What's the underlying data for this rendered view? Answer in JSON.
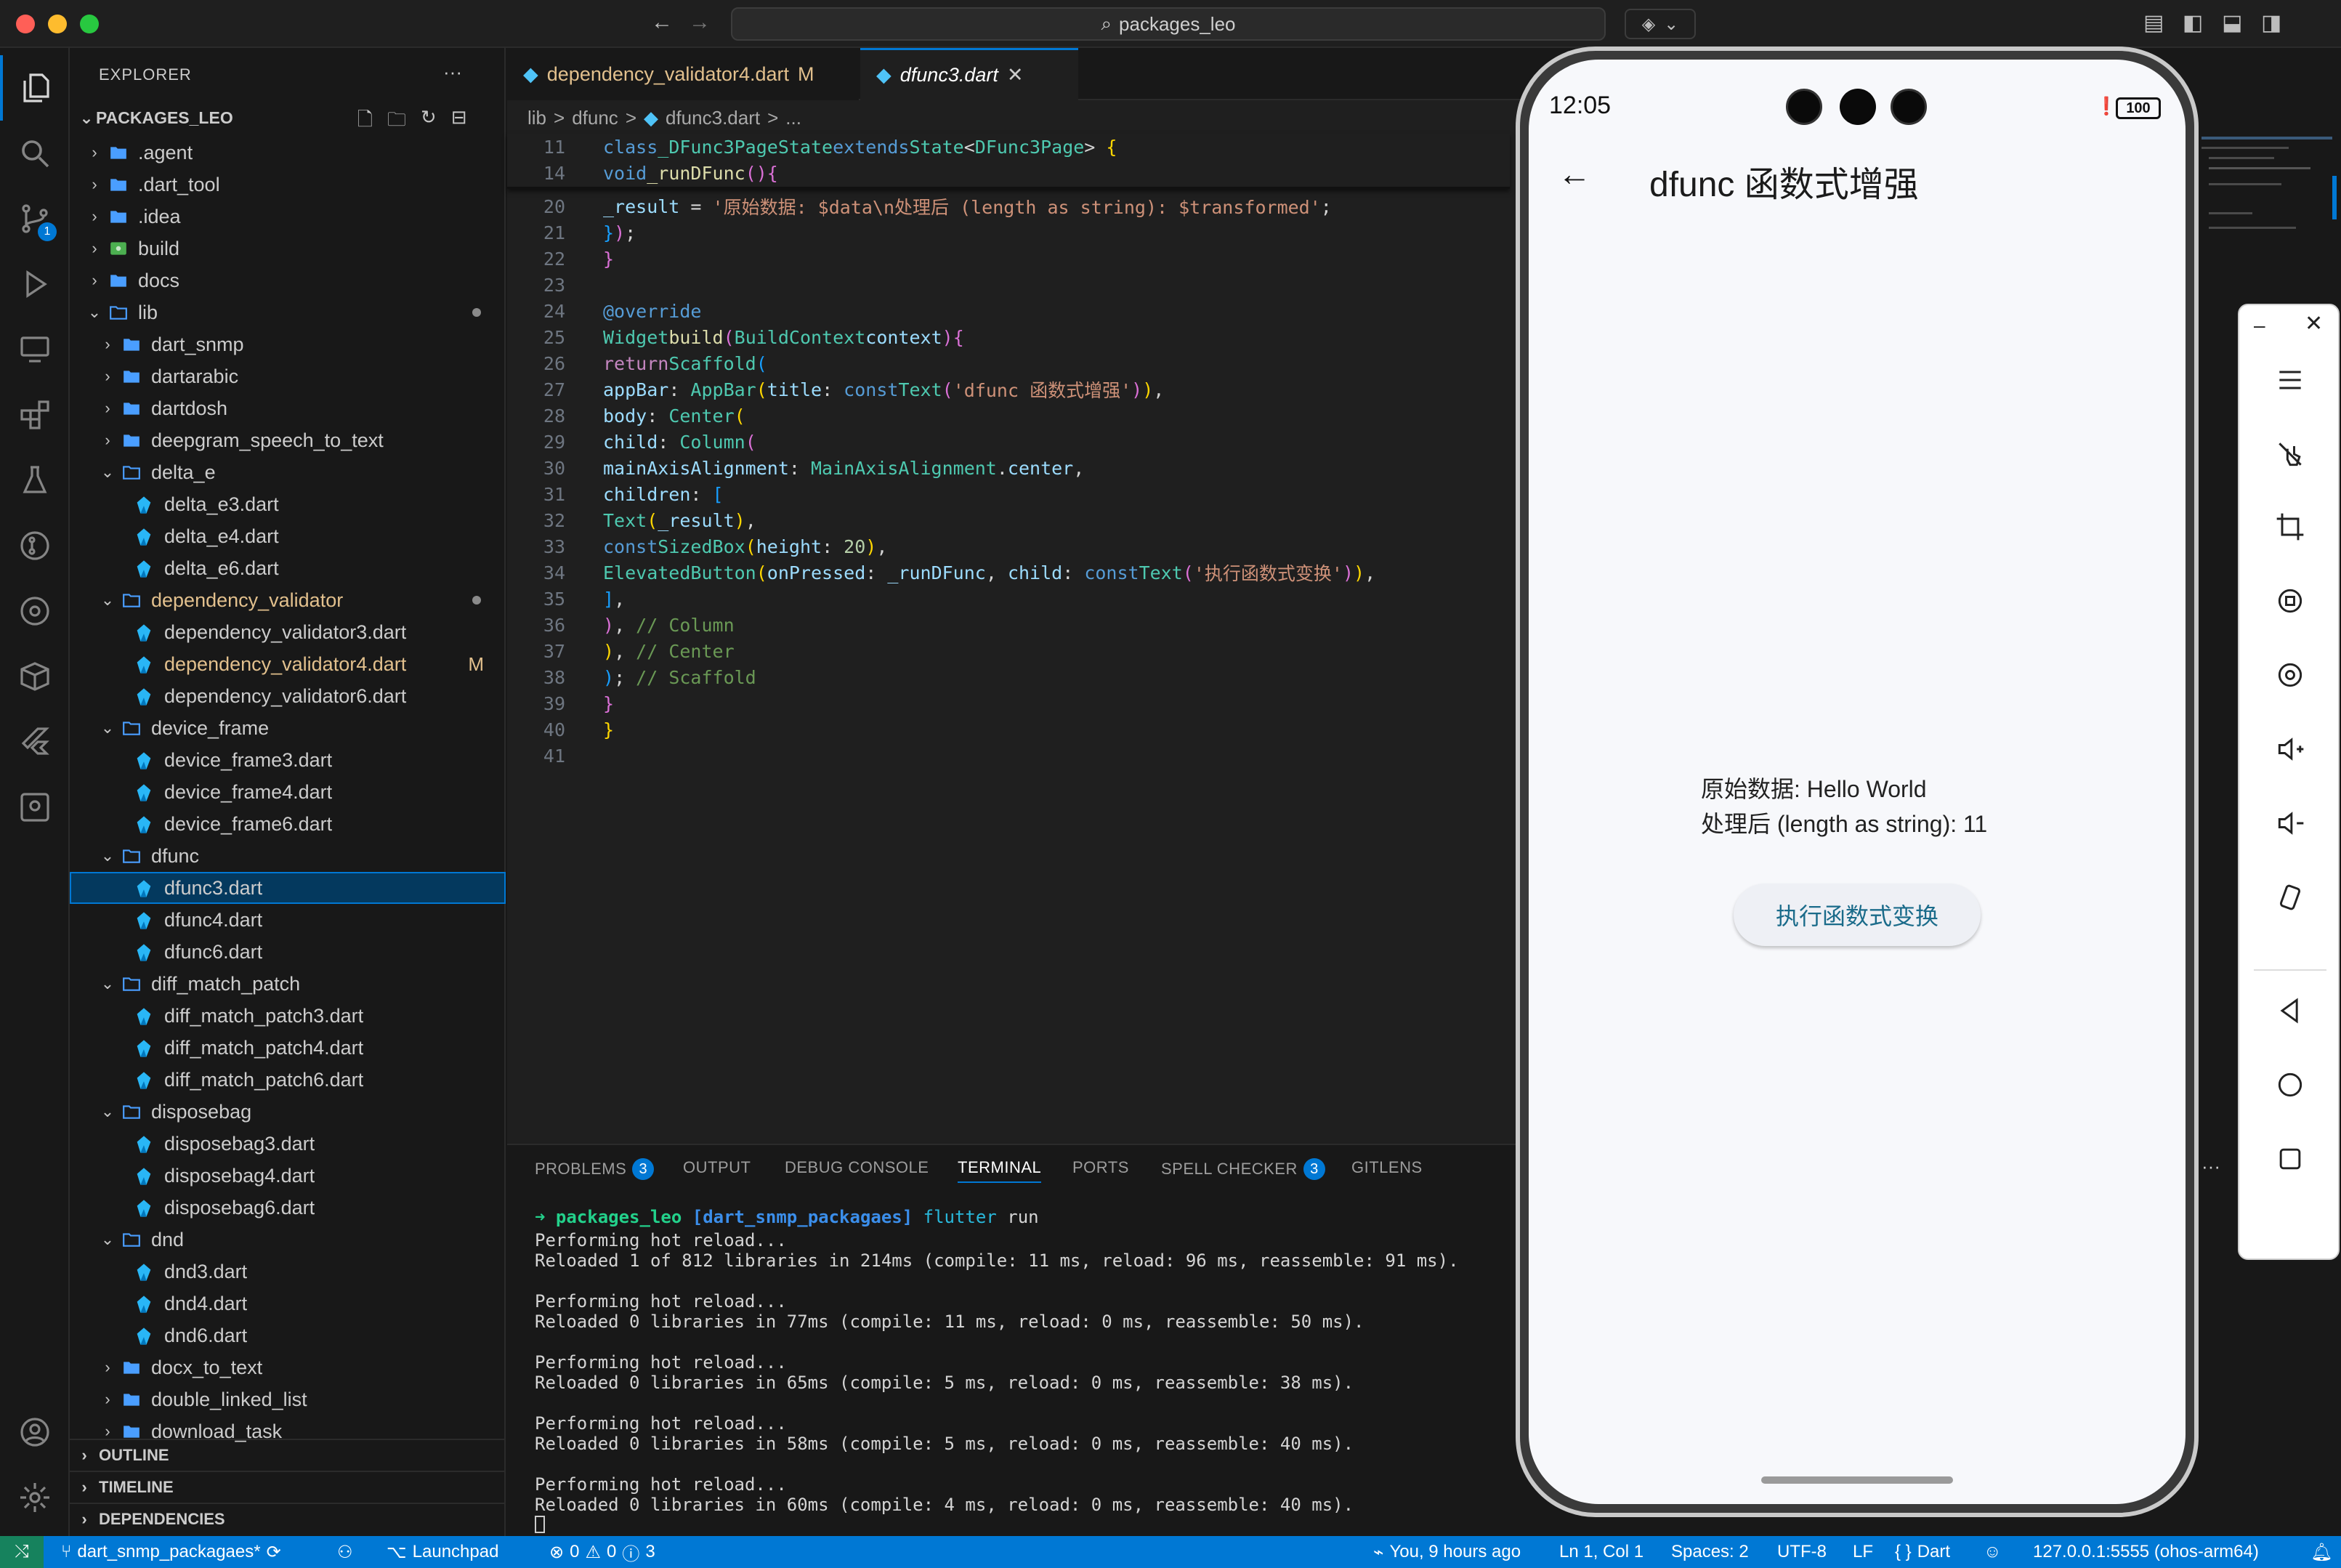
{
  "window": {
    "search_text": "packages_leo"
  },
  "explorer": {
    "title": "EXPLORER",
    "root": "PACKAGES_LEO",
    "items": [
      {
        "label": ".agent",
        "type": "folder",
        "depth": 0
      },
      {
        "label": ".dart_tool",
        "type": "folder",
        "depth": 0
      },
      {
        "label": ".idea",
        "type": "folder",
        "depth": 0
      },
      {
        "label": "build",
        "type": "folder",
        "depth": 0
      },
      {
        "label": "docs",
        "type": "folder",
        "depth": 0
      },
      {
        "label": "lib",
        "type": "folder-open",
        "depth": 0
      },
      {
        "label": "dart_snmp",
        "type": "folder",
        "depth": 1
      },
      {
        "label": "dartarabic",
        "type": "folder",
        "depth": 1
      },
      {
        "label": "dartdosh",
        "type": "folder",
        "depth": 1
      },
      {
        "label": "deepgram_speech_to_text",
        "type": "folder",
        "depth": 1
      },
      {
        "label": "delta_e",
        "type": "folder-open",
        "depth": 1
      },
      {
        "label": "delta_e3.dart",
        "type": "dart",
        "depth": 2
      },
      {
        "label": "delta_e4.dart",
        "type": "dart",
        "depth": 2
      },
      {
        "label": "delta_e6.dart",
        "type": "dart",
        "depth": 2
      },
      {
        "label": "dependency_validator",
        "type": "folder-open",
        "depth": 1
      },
      {
        "label": "dependency_validator3.dart",
        "type": "dart",
        "depth": 2
      },
      {
        "label": "dependency_validator4.dart",
        "type": "dart",
        "depth": 2
      },
      {
        "label": "dependency_validator6.dart",
        "type": "dart",
        "depth": 2
      },
      {
        "label": "device_frame",
        "type": "folder-open",
        "depth": 1
      },
      {
        "label": "device_frame3.dart",
        "type": "dart",
        "depth": 2
      },
      {
        "label": "device_frame4.dart",
        "type": "dart",
        "depth": 2
      },
      {
        "label": "device_frame6.dart",
        "type": "dart",
        "depth": 2
      },
      {
        "label": "dfunc",
        "type": "folder-open",
        "depth": 1
      },
      {
        "label": "dfunc3.dart",
        "type": "dart",
        "depth": 2
      },
      {
        "label": "dfunc4.dart",
        "type": "dart",
        "depth": 2
      },
      {
        "label": "dfunc6.dart",
        "type": "dart",
        "depth": 2
      },
      {
        "label": "diff_match_patch",
        "type": "folder-open",
        "depth": 1
      },
      {
        "label": "diff_match_patch3.dart",
        "type": "dart",
        "depth": 2
      },
      {
        "label": "diff_match_patch4.dart",
        "type": "dart",
        "depth": 2
      },
      {
        "label": "diff_match_patch6.dart",
        "type": "dart",
        "depth": 2
      },
      {
        "label": "disposebag",
        "type": "folder-open",
        "depth": 1
      },
      {
        "label": "disposebag3.dart",
        "type": "dart",
        "depth": 2
      },
      {
        "label": "disposebag4.dart",
        "type": "dart",
        "depth": 2
      },
      {
        "label": "disposebag6.dart",
        "type": "dart",
        "depth": 2
      },
      {
        "label": "dnd",
        "type": "folder-open",
        "depth": 1
      },
      {
        "label": "dnd3.dart",
        "type": "dart",
        "depth": 2
      },
      {
        "label": "dnd4.dart",
        "type": "dart",
        "depth": 2
      },
      {
        "label": "dnd6.dart",
        "type": "dart",
        "depth": 2
      },
      {
        "label": "docx_to_text",
        "type": "folder",
        "depth": 1
      },
      {
        "label": "double_linked_list",
        "type": "folder",
        "depth": 1
      },
      {
        "label": "download_task",
        "type": "folder",
        "depth": 1
      }
    ],
    "modified_flag": "M",
    "sections": [
      "OUTLINE",
      "TIMELINE",
      "DEPENDENCIES"
    ]
  },
  "tabs": [
    {
      "label": "dependency_validator4.dart",
      "flag": "M"
    },
    {
      "label": "dfunc3.dart",
      "close": "✕"
    }
  ],
  "breadcrumb": [
    "lib",
    ">",
    "dfunc",
    ">",
    "dfunc3.dart",
    ">",
    "..."
  ],
  "code_line_numbers": [
    "11",
    "14",
    "20",
    "21",
    "22",
    "23",
    "24",
    "25",
    "26",
    "27",
    "28",
    "29",
    "30",
    "31",
    "32",
    "33",
    "34",
    "35",
    "36",
    "37",
    "38",
    "39",
    "40",
    "41"
  ],
  "panel": {
    "tabs": [
      "PROBLEMS",
      "OUTPUT",
      "DEBUG CONSOLE",
      "TERMINAL",
      "PORTS",
      "SPELL CHECKER",
      "GITLENS"
    ],
    "problems_count": "3",
    "spell_count": "3",
    "prompt_dir": "packages_leo",
    "prompt_branch": "[dart_snmp_packagaes]",
    "prompt_cmd": "flutter",
    "prompt_arg": "run",
    "terminal_lines": [
      "Performing hot reload...",
      "Reloaded 1 of 812 libraries in 214ms (compile: 11 ms, reload: 96 ms, reassemble: 91 ms).",
      "",
      "Performing hot reload...",
      "Reloaded 0 libraries in 77ms (compile: 11 ms, reload: 0 ms, reassemble: 50 ms).",
      "",
      "Performing hot reload...",
      "Reloaded 0 libraries in 65ms (compile: 5 ms, reload: 0 ms, reassemble: 38 ms).",
      "",
      "Performing hot reload...",
      "Reloaded 0 libraries in 58ms (compile: 5 ms, reload: 0 ms, reassemble: 40 ms).",
      "",
      "Performing hot reload...",
      "Reloaded 0 libraries in 60ms (compile: 4 ms, reload: 0 ms, reassemble: 40 ms)."
    ]
  },
  "statusbar": {
    "branch": "dart_snmp_packagaes*",
    "launchpad": "Launchpad",
    "errors": "0",
    "warnings": "0",
    "info": "3",
    "blame": "You, 9 hours ago",
    "position": "Ln 1, Col 1",
    "spaces": "Spaces: 2",
    "encoding": "UTF-8",
    "eol": "LF",
    "language": "Dart",
    "device": "127.0.0.1:5555 (ohos-arm64)"
  },
  "phone": {
    "time": "12:05",
    "battery": "100",
    "app_title": "dfunc 函数式增强",
    "result_line1": "原始数据: Hello World",
    "result_line2": "处理后 (length as string): 11",
    "button_label": "执行函数式变换"
  },
  "colors": {
    "accent": "#0078d4",
    "folder": "#4a9eff",
    "modified": "#e2c08d",
    "phone_button_text": "#1a6b8a"
  }
}
